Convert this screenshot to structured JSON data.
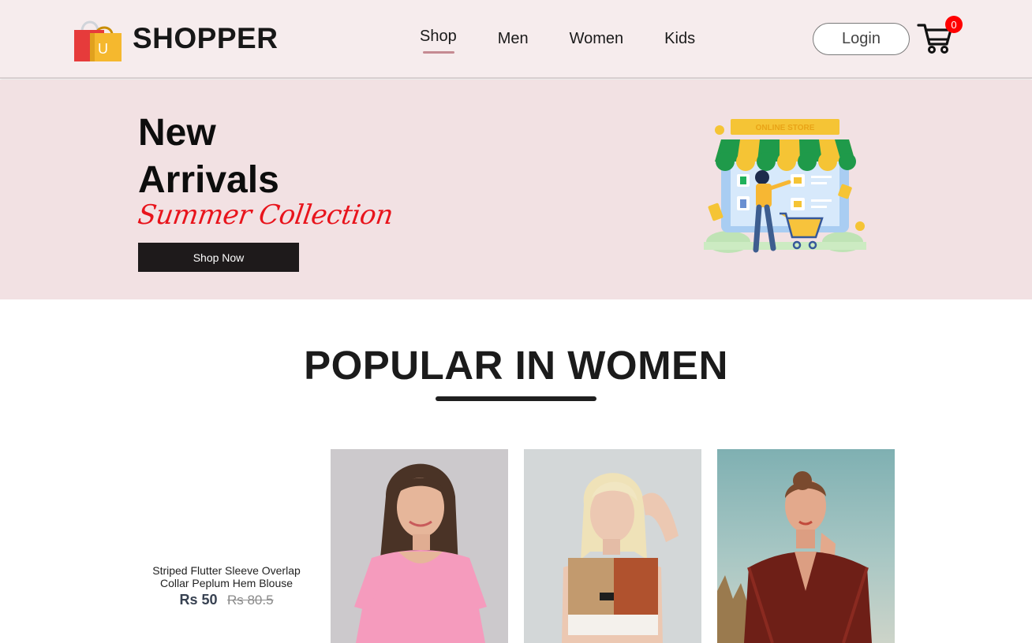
{
  "brand": {
    "name": "SHOPPER",
    "logo_icon": "shopping-bags-icon",
    "logo_letter": "U"
  },
  "nav": {
    "items": [
      {
        "label": "Shop",
        "active": true
      },
      {
        "label": "Men"
      },
      {
        "label": "Women"
      },
      {
        "label": "Kids"
      }
    ],
    "login_label": "Login",
    "cart_icon": "cart-icon",
    "cart_count": "0"
  },
  "hero": {
    "title_line1": "New",
    "title_line2": "Arrivals",
    "subtitle": "Summer Collection",
    "button_label": "Shop Now",
    "illustration_sign": "ONLINE STORE"
  },
  "popular": {
    "title": "POPULAR IN WOMEN",
    "featured": {
      "name": "Striped Flutter Sleeve Overlap Collar Peplum Hem Blouse",
      "price_new": "Rs 50",
      "price_old": "Rs 80.5"
    }
  },
  "colors": {
    "nav_bg": "#f6eced",
    "hero_bg": "#f2e1e3",
    "accent_red": "#e8141c",
    "badge_red": "#ff0000",
    "dark": "#1e1a1b"
  }
}
